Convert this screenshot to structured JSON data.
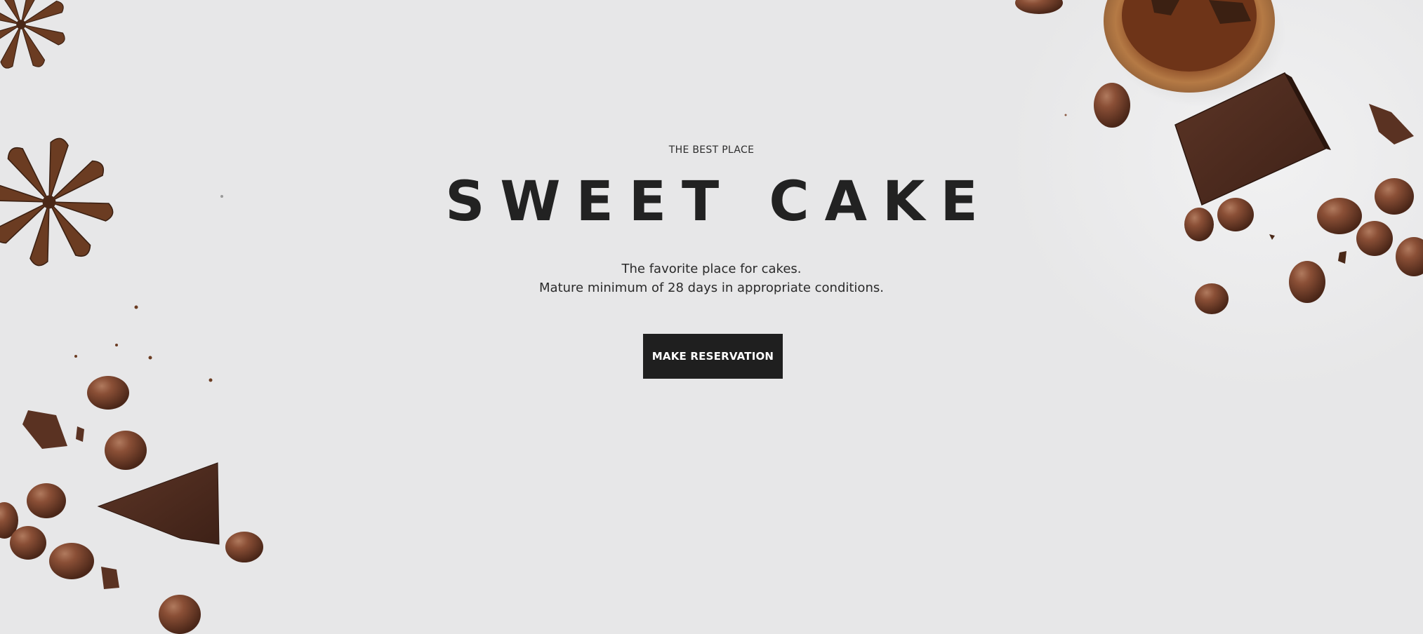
{
  "hero": {
    "eyebrow": "THE BEST PLACE",
    "title": "SWEET CAKE",
    "subtitle_line1": "The favorite place for cakes.",
    "subtitle_line2": "Mature minimum of 28 days in appropriate conditions.",
    "cta_label": "MAKE RESERVATION"
  },
  "colors": {
    "background": "#e7e7e8",
    "title": "#222222",
    "button_bg": "#1f1f1f",
    "button_text": "#ffffff",
    "chocolate": "#5a3222"
  },
  "decor": {
    "left_cluster": [
      "star-anise-icon",
      "chocolate-candy-icon",
      "chocolate-piece-icon"
    ],
    "right_cluster": [
      "wooden-bowl-icon",
      "chocolate-bar-icon",
      "chocolate-candy-icon"
    ]
  }
}
